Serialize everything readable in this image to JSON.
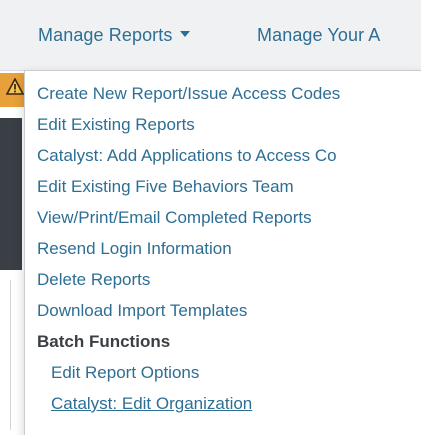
{
  "nav": {
    "manage_reports": "Manage Reports",
    "manage_account": "Manage Your A"
  },
  "menu": {
    "items": [
      "Create New Report/Issue Access Codes",
      "Edit Existing Reports",
      "Catalyst: Add Applications to Access Co",
      "Edit Existing Five Behaviors Team",
      "View/Print/Email Completed Reports",
      "Resend Login Information",
      "Delete Reports",
      "Download Import Templates"
    ],
    "section_header": "Batch Functions",
    "batch_items": [
      "Edit Report Options",
      "Catalyst: Edit Organization"
    ]
  },
  "icons": {
    "warning": "warning-icon",
    "caret": "chevron-down-icon"
  },
  "colors": {
    "link": "#2d6e94",
    "nav_bg": "#f0f1f2",
    "header_text": "#3b3f44",
    "warning": "#e8a03a"
  }
}
